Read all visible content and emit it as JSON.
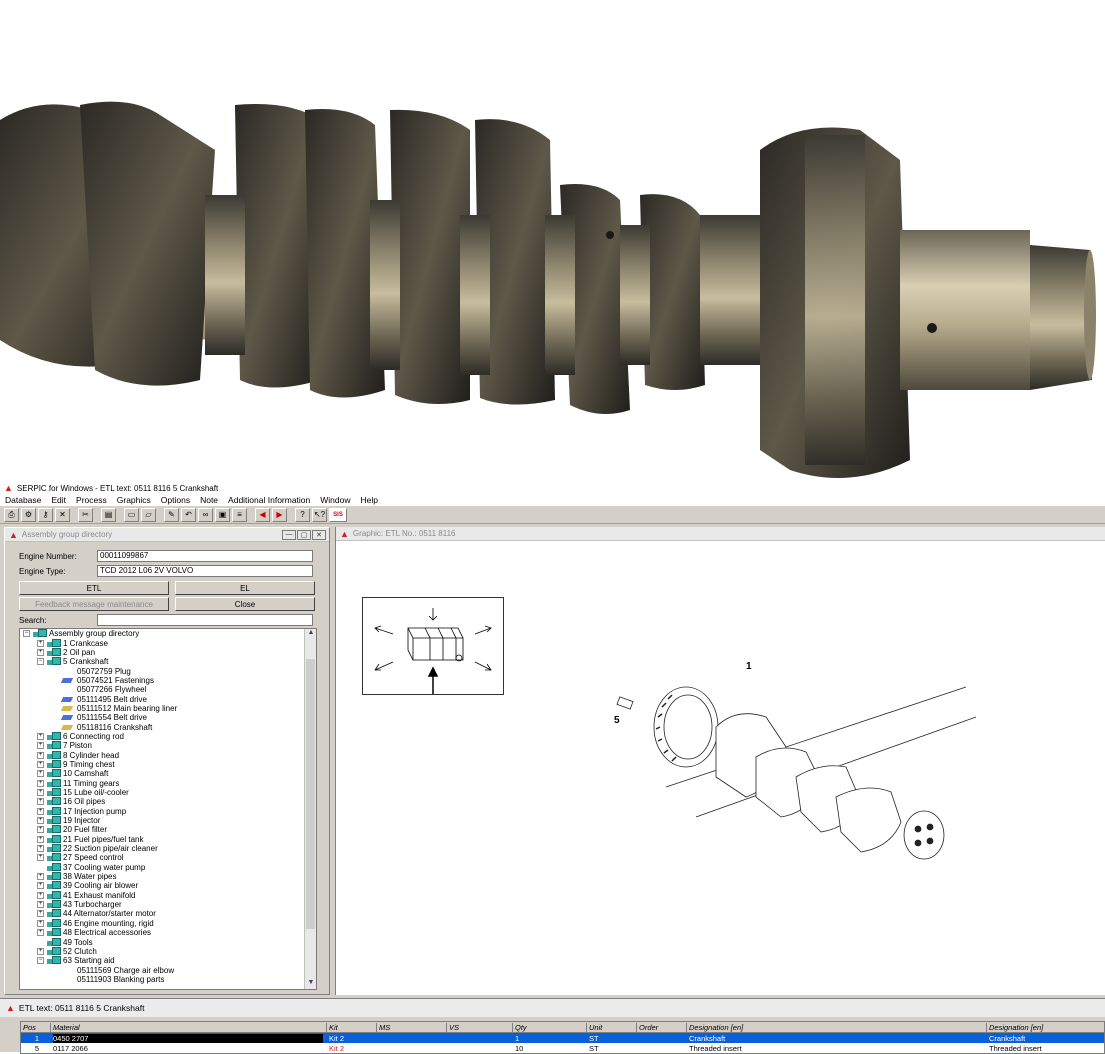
{
  "window": {
    "title": "SERPIC for Windows - ETL text: 0511 8116    5   Crankshaft"
  },
  "menu": [
    "Database",
    "Edit",
    "Process",
    "Graphics",
    "Options",
    "Note",
    "Additional Information",
    "Window",
    "Help"
  ],
  "toolbar": {
    "buttons": [
      "print-icon",
      "tool-icon",
      "key-icon",
      "close-icon",
      "cut-icon",
      "printer-icon",
      "new-icon",
      "open-icon",
      "edit-icon",
      "undo-icon",
      "link-icon",
      "view-icon",
      "list-icon",
      "back-icon",
      "forward-icon",
      "help-icon",
      "context-help-icon",
      "sis-icon"
    ],
    "sis_label": "SIS"
  },
  "assembly": {
    "title": "Assembly group directory",
    "engine_number_label": "Engine Number:",
    "engine_number": "00011099867",
    "engine_type_label": "Engine Type:",
    "engine_type": "TCD 2012 L06 2V VOLVO",
    "etl_button": "ETL",
    "el_button": "EL",
    "feedback_button": "Feedback message maintenance",
    "close_button": "Close",
    "search_label": "Search:",
    "search_value": "",
    "tree": [
      {
        "level": 0,
        "exp": "−",
        "icon": "tree",
        "text": "Assembly group directory"
      },
      {
        "level": 1,
        "exp": "+",
        "icon": "grp",
        "text": "1  Crankcase"
      },
      {
        "level": 1,
        "exp": "+",
        "icon": "grp",
        "text": "2  Oil pan"
      },
      {
        "level": 1,
        "exp": "−",
        "icon": "grp",
        "text": "5  Crankshaft"
      },
      {
        "level": 2,
        "exp": "",
        "icon": "",
        "text": "05072759  Plug"
      },
      {
        "level": 2,
        "exp": "",
        "icon": "part",
        "text": "05074521  Fastenings"
      },
      {
        "level": 2,
        "exp": "",
        "icon": "",
        "text": "05077266  Flywheel"
      },
      {
        "level": 2,
        "exp": "",
        "icon": "part",
        "text": "05111495  Belt drive"
      },
      {
        "level": 2,
        "exp": "",
        "icon": "part2",
        "text": "05111512  Main bearing liner"
      },
      {
        "level": 2,
        "exp": "",
        "icon": "part",
        "text": "05111554  Belt drive"
      },
      {
        "level": 2,
        "exp": "",
        "icon": "part2",
        "text": "05118116  Crankshaft"
      },
      {
        "level": 1,
        "exp": "+",
        "icon": "grp",
        "text": "6  Connecting rod"
      },
      {
        "level": 1,
        "exp": "+",
        "icon": "grp",
        "text": "7  Piston"
      },
      {
        "level": 1,
        "exp": "+",
        "icon": "grp",
        "text": "8  Cylinder head"
      },
      {
        "level": 1,
        "exp": "+",
        "icon": "grp",
        "text": "9  Timing chest"
      },
      {
        "level": 1,
        "exp": "+",
        "icon": "grp",
        "text": "10  Camshaft"
      },
      {
        "level": 1,
        "exp": "+",
        "icon": "grp",
        "text": "11  Timing gears"
      },
      {
        "level": 1,
        "exp": "+",
        "icon": "grp",
        "text": "15  Lube oil/-cooler"
      },
      {
        "level": 1,
        "exp": "+",
        "icon": "grp",
        "text": "16  Oil pipes"
      },
      {
        "level": 1,
        "exp": "+",
        "icon": "grp",
        "text": "17  Injection pump"
      },
      {
        "level": 1,
        "exp": "+",
        "icon": "grp",
        "text": "19  Injector"
      },
      {
        "level": 1,
        "exp": "+",
        "icon": "grp",
        "text": "20  Fuel filter"
      },
      {
        "level": 1,
        "exp": "+",
        "icon": "grp",
        "text": "21  Fuel pipes/fuel tank"
      },
      {
        "level": 1,
        "exp": "+",
        "icon": "grp",
        "text": "22  Suction pipe/air cleaner"
      },
      {
        "level": 1,
        "exp": "+",
        "icon": "grp",
        "text": "27  Speed control"
      },
      {
        "level": 1,
        "exp": "",
        "icon": "grp",
        "text": "37  Cooling water pump"
      },
      {
        "level": 1,
        "exp": "+",
        "icon": "grp",
        "text": "38  Water pipes"
      },
      {
        "level": 1,
        "exp": "+",
        "icon": "grp",
        "text": "39  Cooling air blower"
      },
      {
        "level": 1,
        "exp": "+",
        "icon": "grp",
        "text": "41  Exhaust manifold"
      },
      {
        "level": 1,
        "exp": "+",
        "icon": "grp",
        "text": "43  Turbocharger"
      },
      {
        "level": 1,
        "exp": "+",
        "icon": "grp",
        "text": "44  Alternator/starter motor"
      },
      {
        "level": 1,
        "exp": "+",
        "icon": "grp",
        "text": "46  Engine mounting, rigid"
      },
      {
        "level": 1,
        "exp": "+",
        "icon": "grp",
        "text": "48  Electrical accessories"
      },
      {
        "level": 1,
        "exp": "",
        "icon": "grp",
        "text": "49  Tools"
      },
      {
        "level": 1,
        "exp": "+",
        "icon": "grp",
        "text": "52  Clutch"
      },
      {
        "level": 1,
        "exp": "−",
        "icon": "grp",
        "text": "63  Starting aid"
      },
      {
        "level": 2,
        "exp": "",
        "icon": "",
        "text": "05111569  Charge air elbow"
      },
      {
        "level": 2,
        "exp": "",
        "icon": "",
        "text": "05111903  Blanking parts"
      }
    ]
  },
  "graphic": {
    "title": "Graphic: ETL No.: 0511 8116",
    "label_1": "1",
    "label_5": "5"
  },
  "etl": {
    "title": "ETL text: 0511 8116    5   Crankshaft",
    "headers": [
      "Pos",
      "Material",
      "Kit",
      "MS",
      "VS",
      "Qty",
      "Unit",
      "Order",
      "Designation [en]",
      "Designation [en]"
    ],
    "rows": [
      [
        "1",
        "0450 2707",
        "Kit 2",
        "",
        "",
        "1",
        "ST",
        "",
        "Crankshaft",
        "Crankshaft"
      ],
      [
        "5",
        "0117 2066",
        "Kit 2",
        "",
        "",
        "10",
        "ST",
        "",
        "Threaded insert",
        "Threaded insert"
      ]
    ]
  },
  "colors": {
    "accent": "#0a60d8",
    "serpic_red": "#cc1f1f",
    "window_bg": "#d4d0c8"
  }
}
